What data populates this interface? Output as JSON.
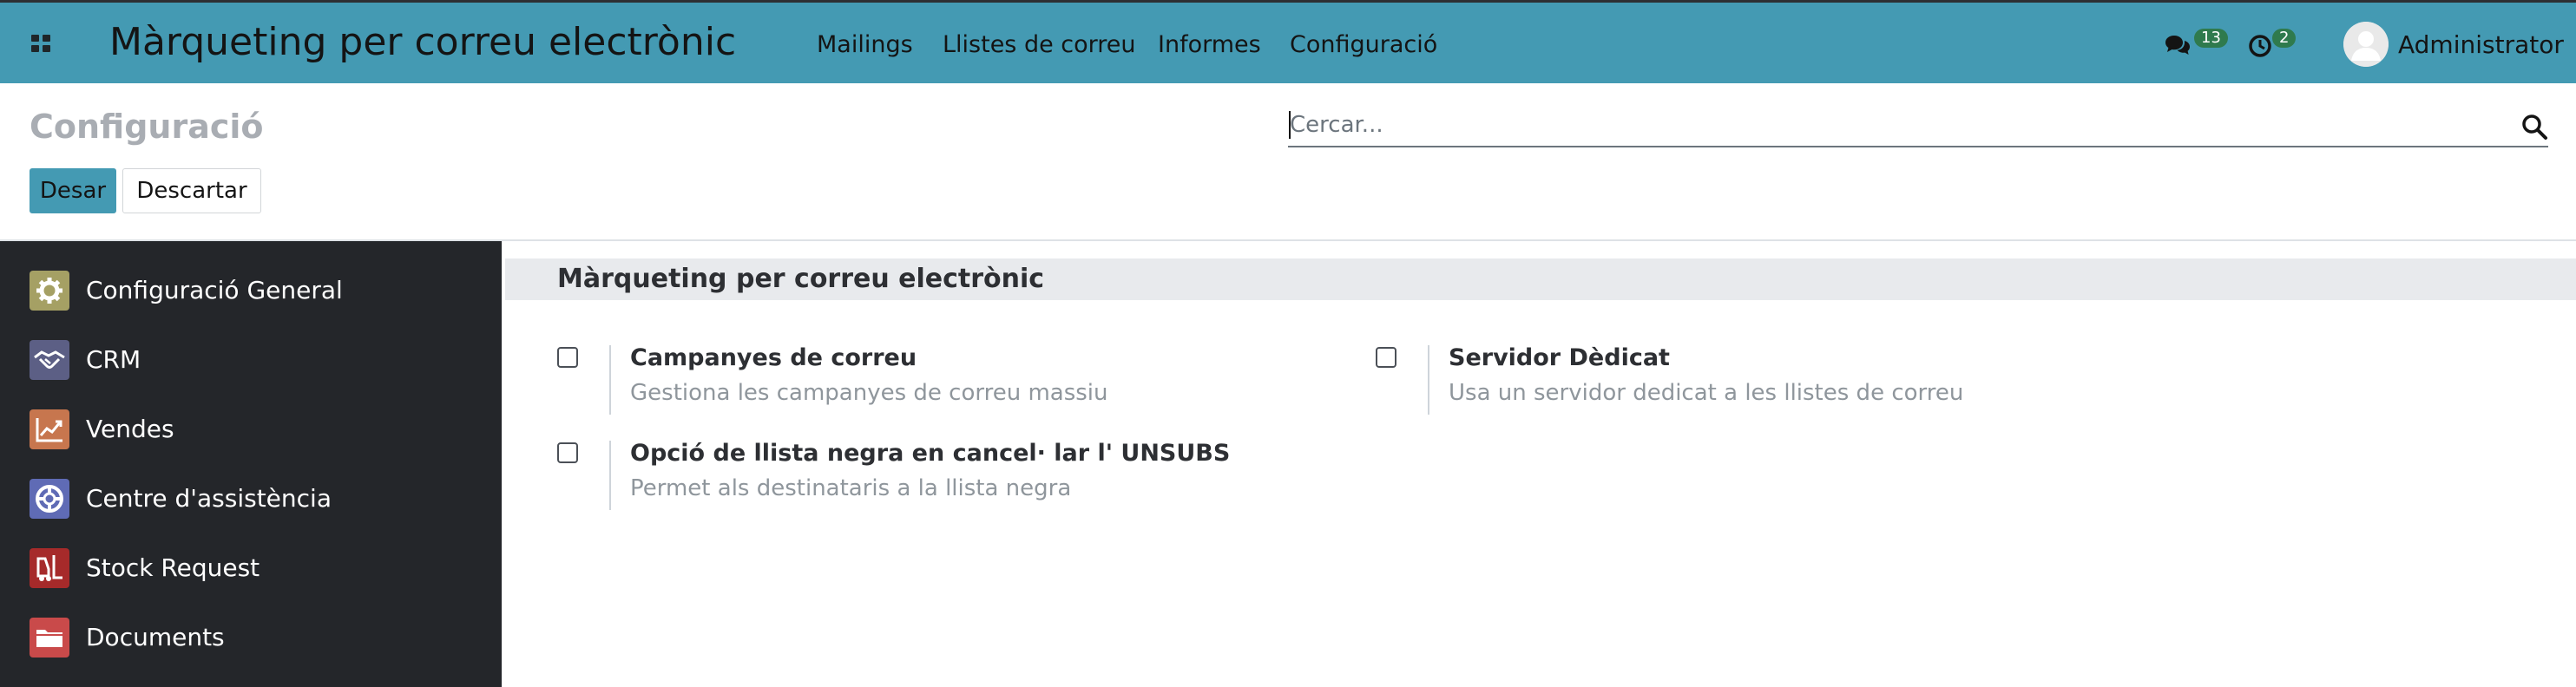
{
  "navbar": {
    "brand": "Màrqueting per correu electrònic",
    "menu": [
      "Mailings",
      "Llistes de correu",
      "Informes",
      "Configuració"
    ],
    "messages_count": "13",
    "activities_count": "2",
    "user_name": "Administrator"
  },
  "control_panel": {
    "title": "Configuració",
    "search_placeholder": "Cercar...",
    "save_label": "Desar",
    "discard_label": "Descartar"
  },
  "sidebar": {
    "items": [
      {
        "label": "Configuració General",
        "icon": "gear-icon",
        "color": "#a5a064"
      },
      {
        "label": "CRM",
        "icon": "handshake-icon",
        "color": "#5c5f85"
      },
      {
        "label": "Vendes",
        "icon": "chart-line-icon",
        "color": "#c7764e"
      },
      {
        "label": "Centre d'assistència",
        "icon": "lifebuoy-icon",
        "color": "#5f6bb5"
      },
      {
        "label": "Stock Request",
        "icon": "forklift-icon",
        "color": "#a62a2a"
      },
      {
        "label": "Documents",
        "icon": "folder-icon",
        "color": "#c94a4a"
      }
    ]
  },
  "settings": {
    "section_title": "Màrqueting per correu electrònic",
    "options": [
      {
        "title": "Campanyes de correu",
        "description": "Gestiona les campanyes de correu massiu",
        "checked": false
      },
      {
        "title": "Servidor Dèdicat",
        "description": "Usa un servidor dedicat a les llistes de correu",
        "checked": false
      },
      {
        "title": "Opció de llista negra en cancel· lar l' UNSUBS",
        "description": "Permet als destinataris a la llista negra",
        "checked": false
      }
    ]
  },
  "colors": {
    "navbar": "#449ab3",
    "sidebar": "#24262a",
    "primary_button": "#449ab3"
  }
}
